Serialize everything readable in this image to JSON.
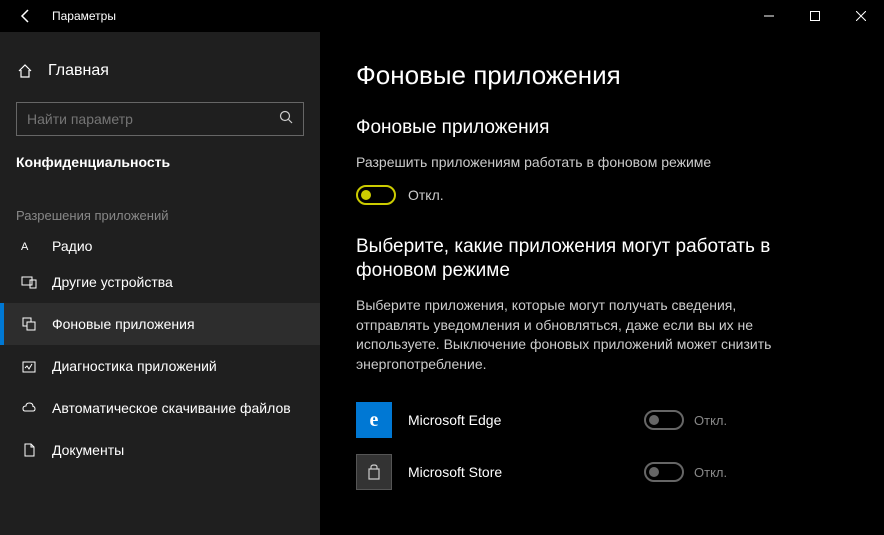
{
  "titlebar": {
    "title": "Параметры"
  },
  "sidebar": {
    "home": "Главная",
    "search_placeholder": "Найти параметр",
    "section": "Конфиденциальность",
    "subsection": "Разрешения приложений",
    "items": [
      {
        "label": "Радио"
      },
      {
        "label": "Другие устройства"
      },
      {
        "label": "Фоновые приложения"
      },
      {
        "label": "Диагностика приложений"
      },
      {
        "label": "Автоматическое скачивание файлов"
      },
      {
        "label": "Документы"
      }
    ]
  },
  "main": {
    "title": "Фоновые приложения",
    "section1_title": "Фоновые приложения",
    "section1_desc": "Разрешить приложениям работать в фоновом режиме",
    "master_toggle_label": "Откл.",
    "section2_title": "Выберите, какие приложения могут работать в фоновом режиме",
    "section2_desc": "Выберите приложения, которые могут получать сведения, отправлять уведомления и обновляться, даже если вы их не используете. Выключение фоновых приложений может снизить энергопотребление.",
    "apps": [
      {
        "name": "Microsoft Edge",
        "state": "Откл."
      },
      {
        "name": "Microsoft Store",
        "state": "Откл."
      }
    ]
  }
}
